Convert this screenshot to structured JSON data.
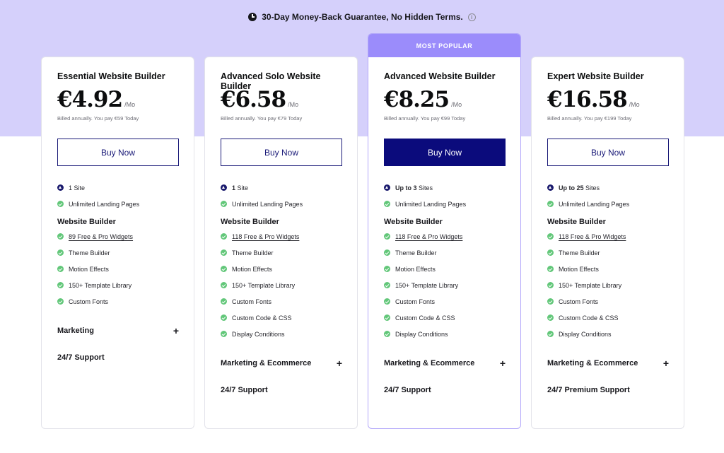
{
  "banner": {
    "guarantee_text": "30-Day Money-Back Guarantee, No Hidden Terms.",
    "info_glyph": "i"
  },
  "colors": {
    "band": "#d5d0fb",
    "accent": "#9b8cfb",
    "primary": "#0b0b7c",
    "check": "#62c779"
  },
  "plans": [
    {
      "name": "Essential Website Builder",
      "price": "€4.92",
      "per": "/Mo",
      "billed": "Billed annually. You pay €59 Today",
      "buy_label": "Buy Now",
      "sites_bold": "",
      "sites_text": "1 Site",
      "landing": "Unlimited Landing Pages",
      "section": "Website Builder",
      "features": [
        "89 Free & Pro Widgets",
        "Theme Builder",
        "Motion Effects",
        "150+ Template Library",
        "Custom Fonts"
      ],
      "accordion": "Marketing",
      "accordion_icon": "+",
      "support": "24/7 Support"
    },
    {
      "name": "Advanced Solo Website Builder",
      "price": "€6.58",
      "per": "/Mo",
      "billed": "Billed annually. You pay €79 Today",
      "buy_label": "Buy Now",
      "sites_bold": "1",
      "sites_text": "Site",
      "landing": "Unlimited Landing Pages",
      "section": "Website Builder",
      "features": [
        "118 Free & Pro Widgets",
        "Theme Builder",
        "Motion Effects",
        "150+ Template Library",
        "Custom Fonts",
        "Custom Code & CSS",
        "Display Conditions"
      ],
      "accordion": "Marketing & Ecommerce",
      "accordion_icon": "+",
      "support": "24/7 Support"
    },
    {
      "badge": "MOST POPULAR",
      "name": "Advanced Website Builder",
      "price": "€8.25",
      "per": "/Mo",
      "billed": "Billed annually. You pay €99 Today",
      "buy_label": "Buy Now",
      "sites_bold": "Up to 3",
      "sites_text": "Sites",
      "landing": "Unlimited Landing Pages",
      "section": "Website Builder",
      "features": [
        "118 Free & Pro Widgets",
        "Theme Builder",
        "Motion Effects",
        "150+ Template Library",
        "Custom Fonts",
        "Custom Code & CSS",
        "Display Conditions"
      ],
      "accordion": "Marketing & Ecommerce",
      "accordion_icon": "+",
      "support": "24/7 Support"
    },
    {
      "name": "Expert Website Builder",
      "price": "€16.58",
      "per": "/Mo",
      "billed": "Billed annually. You pay €199 Today",
      "buy_label": "Buy Now",
      "sites_bold": "Up to 25",
      "sites_text": "Sites",
      "landing": "Unlimited Landing Pages",
      "section": "Website Builder",
      "features": [
        "118 Free & Pro Widgets",
        "Theme Builder",
        "Motion Effects",
        "150+ Template Library",
        "Custom Fonts",
        "Custom Code & CSS",
        "Display Conditions"
      ],
      "accordion": "Marketing & Ecommerce",
      "accordion_icon": "+",
      "support": "24/7 Premium Support"
    }
  ]
}
